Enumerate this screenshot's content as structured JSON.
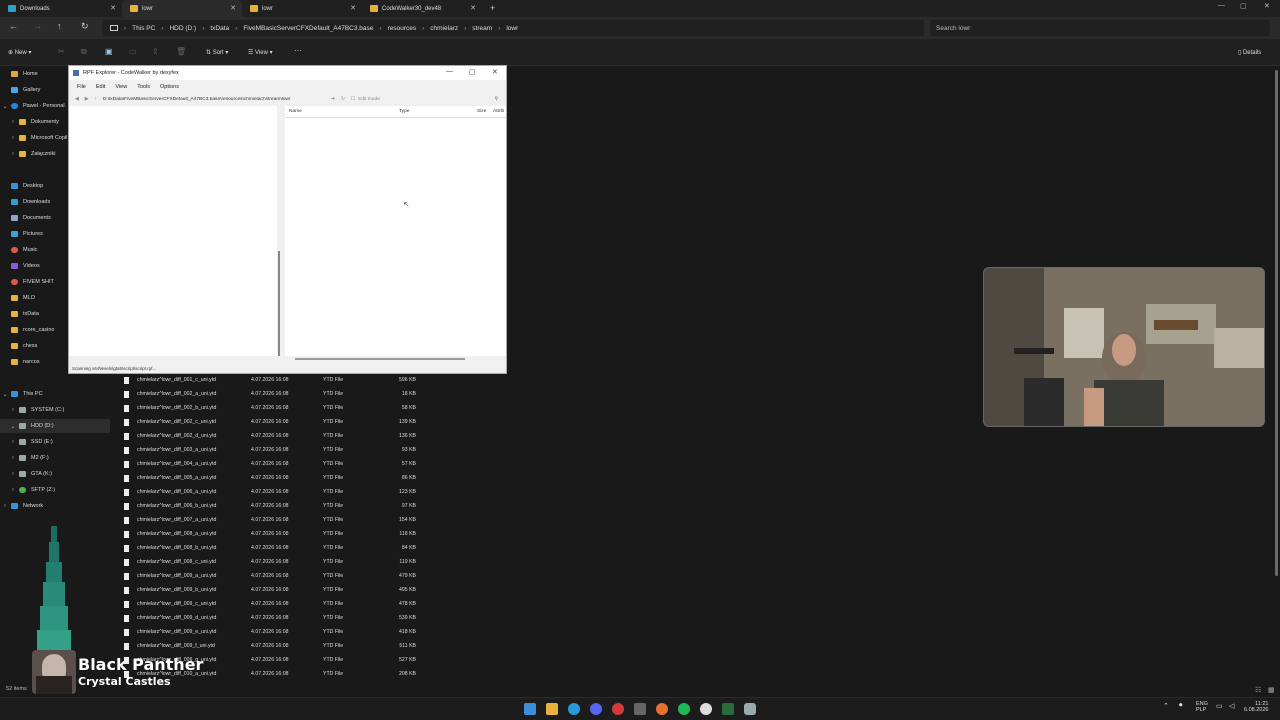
{
  "tabs": [
    {
      "label": "Downloads"
    },
    {
      "label": "lowr"
    },
    {
      "label": "lowr"
    },
    {
      "label": "CodeWalker30_dev48"
    }
  ],
  "breadcrumb": [
    "This PC",
    "HDD (D:)",
    "txData",
    "FiveMBasicServerCFXDefault_A47BC3.base",
    "resources",
    "chmielarz",
    "stream",
    "lowr"
  ],
  "search": {
    "placeholder": "Search lowr"
  },
  "toolbar": {
    "new_label": "New",
    "sort_label": "Sort",
    "view_label": "View",
    "details_label": "Details"
  },
  "sidebar": {
    "items": [
      {
        "label": "Home",
        "color": "#e6a33a"
      },
      {
        "label": "Gallery",
        "color": "#4ea5e8"
      },
      {
        "label": "Pawel - Personal",
        "color": "#2d84d6"
      },
      {
        "label": "Dokumenty",
        "color": "#e8b23a"
      },
      {
        "label": "Microsoft Copilot",
        "color": "#e8b23a"
      },
      {
        "label": "Załączniki",
        "color": "#e8b23a"
      },
      {
        "label": "Desktop",
        "color": "#3c8fd8"
      },
      {
        "label": "Downloads",
        "color": "#2f9fd0"
      },
      {
        "label": "Documents",
        "color": "#8ea6c8"
      },
      {
        "label": "Pictures",
        "color": "#3d9fd8"
      },
      {
        "label": "Music",
        "color": "#e05a4a"
      },
      {
        "label": "Videos",
        "color": "#8a5ad8"
      },
      {
        "label": "FIVEM SHIT",
        "color": "#e0584a"
      },
      {
        "label": "MLO",
        "color": "#e8b23a"
      },
      {
        "label": "txData",
        "color": "#e8b23a"
      },
      {
        "label": "rcore_casino",
        "color": "#e8b23a"
      },
      {
        "label": "chess",
        "color": "#e8b23a"
      },
      {
        "label": "narcos",
        "color": "#e8b23a"
      }
    ],
    "drives": [
      {
        "label": "This PC"
      },
      {
        "label": "SYSTEM (C:)"
      },
      {
        "label": "HDD (D:)"
      },
      {
        "label": "SSD (E:)"
      },
      {
        "label": "M2 (F:)"
      },
      {
        "label": "GTA (K:)"
      },
      {
        "label": "SFTP (Z:)"
      },
      {
        "label": "Network"
      }
    ]
  },
  "files": [
    {
      "name": "chmielarz^lowr_diff_001_c_uni.ytd",
      "date": "4.07.2026 16:08",
      "type": "YTD File",
      "size": "596 KB"
    },
    {
      "name": "chmielarz^lowr_diff_002_a_uni.ytd",
      "date": "4.07.2026 16:08",
      "type": "YTD File",
      "size": "18 KB"
    },
    {
      "name": "chmielarz^lowr_diff_002_b_uni.ytd",
      "date": "4.07.2026 16:08",
      "type": "YTD File",
      "size": "58 KB"
    },
    {
      "name": "chmielarz^lowr_diff_002_c_uni.ytd",
      "date": "4.07.2026 16:08",
      "type": "YTD File",
      "size": "139 KB"
    },
    {
      "name": "chmielarz^lowr_diff_002_d_uni.ytd",
      "date": "4.07.2026 16:08",
      "type": "YTD File",
      "size": "136 KB"
    },
    {
      "name": "chmielarz^lowr_diff_003_a_uni.ytd",
      "date": "4.07.2026 16:08",
      "type": "YTD File",
      "size": "93 KB"
    },
    {
      "name": "chmielarz^lowr_diff_004_a_uni.ytd",
      "date": "4.07.2026 16:08",
      "type": "YTD File",
      "size": "57 KB"
    },
    {
      "name": "chmielarz^lowr_diff_005_a_uni.ytd",
      "date": "4.07.2026 16:08",
      "type": "YTD File",
      "size": "86 KB"
    },
    {
      "name": "chmielarz^lowr_diff_006_a_uni.ytd",
      "date": "4.07.2026 16:08",
      "type": "YTD File",
      "size": "123 KB"
    },
    {
      "name": "chmielarz^lowr_diff_006_b_uni.ytd",
      "date": "4.07.2026 16:08",
      "type": "YTD File",
      "size": "97 KB"
    },
    {
      "name": "chmielarz^lowr_diff_007_a_uni.ytd",
      "date": "4.07.2026 16:08",
      "type": "YTD File",
      "size": "154 KB"
    },
    {
      "name": "chmielarz^lowr_diff_008_a_uni.ytd",
      "date": "4.07.2026 16:08",
      "type": "YTD File",
      "size": "118 KB"
    },
    {
      "name": "chmielarz^lowr_diff_008_b_uni.ytd",
      "date": "4.07.2026 16:08",
      "type": "YTD File",
      "size": "84 KB"
    },
    {
      "name": "chmielarz^lowr_diff_008_c_uni.ytd",
      "date": "4.07.2026 16:08",
      "type": "YTD File",
      "size": "119 KB"
    },
    {
      "name": "chmielarz^lowr_diff_009_a_uni.ytd",
      "date": "4.07.2026 16:08",
      "type": "YTD File",
      "size": "479 KB"
    },
    {
      "name": "chmielarz^lowr_diff_009_b_uni.ytd",
      "date": "4.07.2026 16:08",
      "type": "YTD File",
      "size": "495 KB"
    },
    {
      "name": "chmielarz^lowr_diff_009_c_uni.ytd",
      "date": "4.07.2026 16:08",
      "type": "YTD File",
      "size": "478 KB"
    },
    {
      "name": "chmielarz^lowr_diff_009_d_uni.ytd",
      "date": "4.07.2026 16:08",
      "type": "YTD File",
      "size": "539 KB"
    },
    {
      "name": "chmielarz^lowr_diff_009_e_uni.ytd",
      "date": "4.07.2026 16:08",
      "type": "YTD File",
      "size": "418 KB"
    },
    {
      "name": "chmielarz^lowr_diff_009_f_uni.ytd",
      "date": "4.07.2026 16:08",
      "type": "YTD File",
      "size": "511 KB"
    },
    {
      "name": "chmielarz^lowr_diff_009_g_uni.ytd",
      "date": "4.07.2026 16:08",
      "type": "YTD File",
      "size": "527 KB"
    },
    {
      "name": "chmielarz^lowr_diff_010_a_uni.ytd",
      "date": "4.07.2026 16:08",
      "type": "YTD File",
      "size": "208 KB"
    }
  ],
  "status": {
    "item_count": "52 items"
  },
  "codewalker": {
    "title": "RPF Explorer - CodeWalker by dexyfex",
    "menu": [
      "File",
      "Edit",
      "View",
      "Tools",
      "Options"
    ],
    "path": "D:\\txData\\FiveMBasicServerCFXDefault_A47BC3.base\\resources\\chmielarz\\stream\\lowr",
    "edit_mode": "Edit mode",
    "columns": {
      "name": "Name",
      "type": "Type",
      "size": "Size",
      "attr": "Attrib"
    },
    "status": "Scanning x64\\levels\\gta5\\script\\script.rpf..."
  },
  "music": {
    "title": "Black Panther",
    "artist": "Crystal Castles"
  },
  "tray": {
    "lang1": "ENG",
    "lang2": "PLP",
    "time": "11:21",
    "date": "6.08.2026"
  }
}
